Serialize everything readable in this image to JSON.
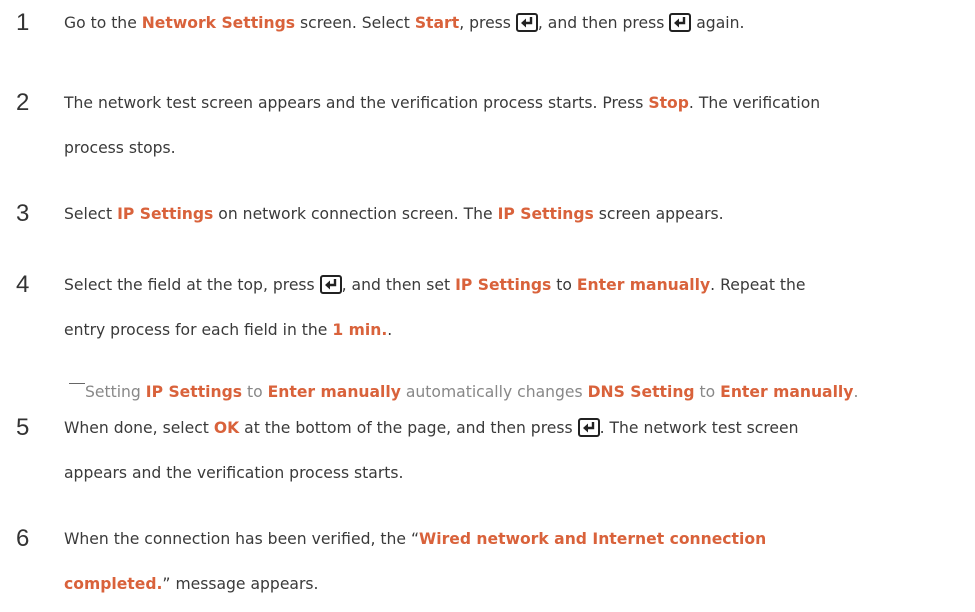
{
  "steps": [
    {
      "num": "1",
      "lines": [
        [
          {
            "t": "Go to the "
          },
          {
            "t": "Network Settings",
            "hl": true
          },
          {
            "t": " screen. Select "
          },
          {
            "t": "Start",
            "hl": true
          },
          {
            "t": ", press "
          },
          {
            "icon": "enter-key-icon"
          },
          {
            "t": ", and then press "
          },
          {
            "icon": "enter-key-icon"
          },
          {
            "t": " again."
          }
        ]
      ]
    },
    {
      "num": "2",
      "lines": [
        [
          {
            "t": "The network test screen appears and the verification process starts. Press "
          },
          {
            "t": "Stop",
            "hl": true
          },
          {
            "t": ". The verification"
          }
        ],
        [
          {
            "t": "process stops."
          }
        ]
      ]
    },
    {
      "num": "3",
      "lines": [
        [
          {
            "t": "Select "
          },
          {
            "t": "IP Settings",
            "hl": true
          },
          {
            "t": " on network connection screen. The "
          },
          {
            "t": "IP Settings",
            "hl": true
          },
          {
            "t": " screen appears."
          }
        ]
      ]
    },
    {
      "num": "4",
      "lines": [
        [
          {
            "t": "Select the field at the top, press "
          },
          {
            "icon": "enter-key-icon"
          },
          {
            "t": ", and then set "
          },
          {
            "t": "IP Settings",
            "hl": true
          },
          {
            "t": " to "
          },
          {
            "t": "Enter manually",
            "hl": true
          },
          {
            "t": ". Repeat the"
          }
        ],
        [
          {
            "t": "entry process for each field in the "
          },
          {
            "t": "1 min.",
            "hl": true
          },
          {
            "t": "."
          }
        ]
      ]
    },
    {
      "num": "5",
      "lines": [
        [
          {
            "t": "When done, select "
          },
          {
            "t": "OK",
            "hl": true
          },
          {
            "t": " at the bottom of the page, and then press "
          },
          {
            "icon": "enter-key-icon"
          },
          {
            "t": ". The network test screen"
          }
        ],
        [
          {
            "t": "appears and the verification process starts."
          }
        ]
      ]
    },
    {
      "num": "6",
      "lines": [
        [
          {
            "t": "When the connection has been verified, the “"
          },
          {
            "t": "Wired network and Internet connection",
            "hl": true
          }
        ],
        [
          {
            "t": "completed.",
            "hl": true
          },
          {
            "t": "” message appears."
          }
        ]
      ]
    }
  ],
  "note": [
    {
      "t": "Setting "
    },
    {
      "t": "IP Settings",
      "hl": true
    },
    {
      "t": " to "
    },
    {
      "t": "Enter manually",
      "hl": true
    },
    {
      "t": " automatically changes "
    },
    {
      "t": "DNS Setting",
      "hl": true
    },
    {
      "t": " to "
    },
    {
      "t": "Enter manually",
      "hl": true
    },
    {
      "t": "."
    }
  ],
  "colors": {
    "highlight": "#d9623b",
    "body_text": "#3a3a3a",
    "note_text": "#888888"
  }
}
